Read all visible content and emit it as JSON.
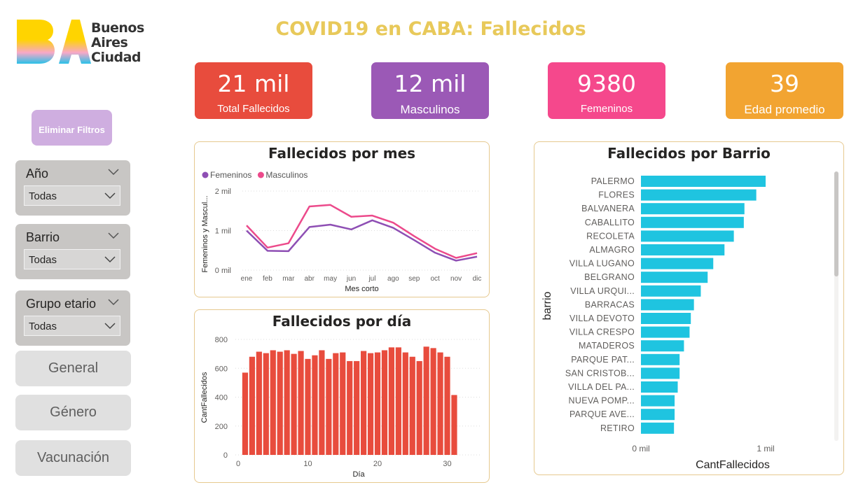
{
  "logo": {
    "line1": "Buenos",
    "line2": "Aires",
    "line3": "Ciudad"
  },
  "title": "COVID19 en CABA: Fallecidos",
  "kpis": [
    {
      "value": "21 mil",
      "label": "Total Fallecidos",
      "color": "#e84c3d"
    },
    {
      "value": "12 mil",
      "label": "Masculinos",
      "color": "#9b59b6"
    },
    {
      "value": "9380",
      "label": "Femeninos",
      "color": "#f5488c"
    },
    {
      "value": "39",
      "label": "Edad promedio",
      "color": "#f2a431"
    }
  ],
  "sidebar": {
    "clear_filters": "Eliminar Filtros",
    "slicers": [
      {
        "label": "Año",
        "value": "Todas"
      },
      {
        "label": "Barrio",
        "value": "Todas"
      },
      {
        "label": "Grupo etario",
        "value": "Todas"
      }
    ],
    "nav": [
      "General",
      "Género",
      "Vacunación"
    ]
  },
  "chart_data": [
    {
      "type": "line",
      "title": "Fallecidos por mes",
      "xlabel": "Mes corto",
      "ylabel": "Femeninos y Mascul...",
      "categories": [
        "ene",
        "feb",
        "mar",
        "abr",
        "may",
        "jun",
        "jul",
        "ago",
        "sep",
        "oct",
        "nov",
        "dic"
      ],
      "y_ticks": [
        "0 mil",
        "1 mil",
        "2 mil"
      ],
      "ylim": [
        0,
        2000
      ],
      "legend_position": "top-left",
      "series": [
        {
          "name": "Femeninos",
          "color": "#8e4fb4",
          "values": [
            1000,
            490,
            480,
            1090,
            1150,
            1030,
            1260,
            1070,
            760,
            440,
            240,
            340
          ]
        },
        {
          "name": "Masculinos",
          "color": "#ec4a8b",
          "values": [
            1130,
            570,
            680,
            1610,
            1650,
            1350,
            1380,
            1200,
            860,
            540,
            310,
            430
          ]
        }
      ]
    },
    {
      "type": "bar",
      "title": "Fallecidos por día",
      "xlabel": "Día",
      "ylabel": "CantFallecidos",
      "ylim": [
        0,
        800
      ],
      "y_ticks": [
        0,
        200,
        400,
        600,
        800
      ],
      "x_ticks": [
        0,
        10,
        20,
        30
      ],
      "color": "#e84c3d",
      "x": [
        1,
        2,
        3,
        4,
        5,
        6,
        7,
        8,
        9,
        10,
        11,
        12,
        13,
        14,
        15,
        16,
        17,
        18,
        19,
        20,
        21,
        22,
        23,
        24,
        25,
        26,
        27,
        28,
        29,
        30,
        31
      ],
      "values": [
        570,
        680,
        715,
        705,
        725,
        715,
        725,
        700,
        720,
        665,
        690,
        725,
        665,
        705,
        710,
        650,
        650,
        720,
        705,
        710,
        725,
        745,
        745,
        710,
        680,
        650,
        750,
        740,
        710,
        680,
        415
      ]
    },
    {
      "type": "bar",
      "orientation": "horizontal",
      "title": "Fallecidos por Barrio",
      "xlabel": "CantFallecidos",
      "ylabel": "barrio",
      "x_ticks": [
        "0 mil",
        "1 mil"
      ],
      "xlim": [
        0,
        1000
      ],
      "color": "#1fc4e0",
      "categories": [
        "PALERMO",
        "FLORES",
        "BALVANERA",
        "CABALLITO",
        "RECOLETA",
        "ALMAGRO",
        "VILLA LUGANO",
        "BELGRANO",
        "VILLA URQUI...",
        "BARRACAS",
        "VILLA DEVOTO",
        "VILLA CRESPO",
        "MATADEROS",
        "PARQUE PAT...",
        "SAN CRISTOB...",
        "VILLA DEL PA...",
        "NUEVA POMP...",
        "PARQUE AVE...",
        "RETIRO"
      ],
      "values": [
        1000,
        925,
        830,
        825,
        745,
        670,
        580,
        535,
        480,
        425,
        400,
        390,
        345,
        310,
        310,
        295,
        270,
        270,
        265
      ]
    }
  ]
}
